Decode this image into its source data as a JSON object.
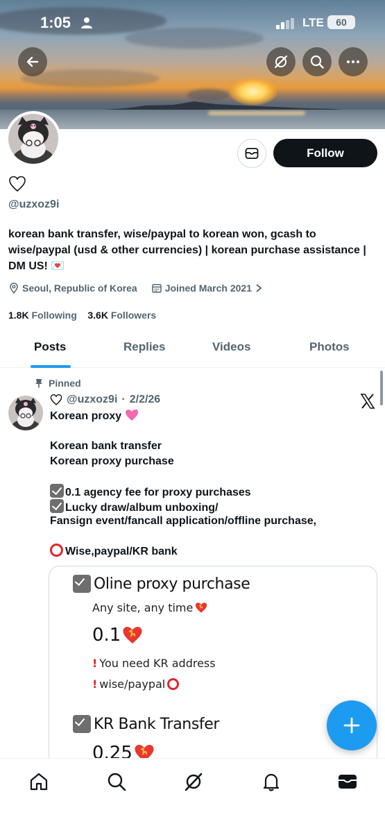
{
  "status_bar": {
    "time": "1:05",
    "network": "LTE",
    "battery": "60"
  },
  "profile": {
    "handle": "@uzxoz9i",
    "bio": "korean bank transfer, wise/paypal to korean won, gcash to wise/paypal (usd & other currencies) | korean purchase assistance | DM US! 💌",
    "location": "Seoul, Republic of Korea",
    "joined": "Joined March 2021",
    "following_count": "1.8K",
    "following_label": "Following",
    "followers_count": "3.6K",
    "followers_label": "Followers",
    "follow_label": "Follow"
  },
  "tabs": [
    {
      "label": "Posts",
      "active": true
    },
    {
      "label": "Replies",
      "active": false
    },
    {
      "label": "Videos",
      "active": false
    },
    {
      "label": "Photos",
      "active": false
    }
  ],
  "post": {
    "pinned_label": "Pinned",
    "handle": "@uzxoz9i",
    "date": "2/2/26",
    "lines": [
      "Korean proxy",
      "",
      "Korean bank transfer",
      "Korean proxy purchase",
      "",
      "0.1 agency fee for proxy purchases",
      "Lucky draw/album unboxing/",
      "Fansign event/fancall application/offline purchase,",
      "",
      "Wise,paypal/KR bank"
    ],
    "card": {
      "heading1": "Oline proxy purchase",
      "sub1": "Any site, any time",
      "big1": "0.1",
      "note1": "You need KR address",
      "note2": "wise/paypal",
      "heading2": "KR Bank Transfer",
      "big2": "0.25"
    }
  },
  "colors": {
    "accent": "#1d9bf0",
    "text": "#0f1419",
    "secondary": "#536471"
  }
}
